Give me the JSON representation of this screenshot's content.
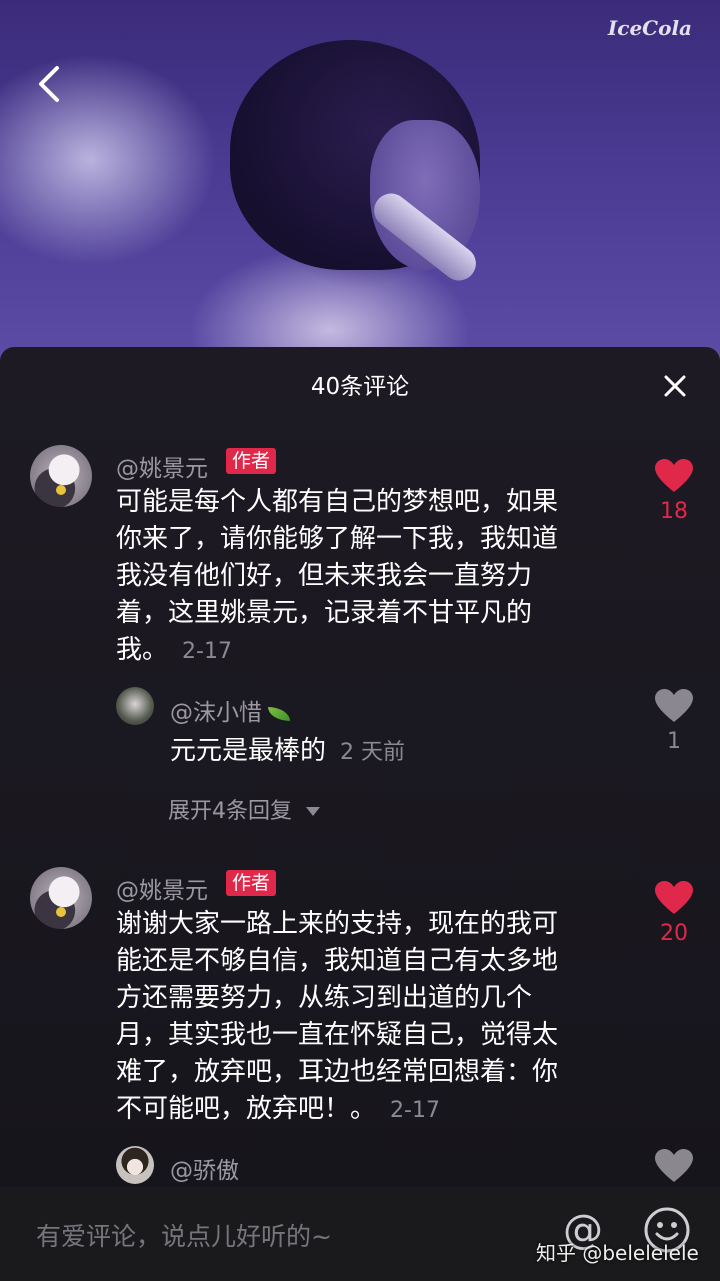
{
  "hero": {
    "watermark": "IceCola"
  },
  "sheet": {
    "title": "40条评论"
  },
  "comments": [
    {
      "username": "@姚景元",
      "badge": "作者",
      "text_lines": [
        "可能是每个人都有自己的梦想吧，如果",
        "你来了，请你能够了解一下我，我知道",
        "我没有他们好，但未来我会一直努力",
        "着，这里姚景元，记录着不甘平凡的"
      ],
      "last_line": "我。",
      "time": "2-17",
      "likes": "18",
      "liked": true,
      "reply": {
        "username": "@沫小惜",
        "text": "元元是最棒的",
        "time": "2 天前",
        "likes": "1",
        "liked": false
      },
      "expand_label": "展开4条回复"
    },
    {
      "username": "@姚景元",
      "badge": "作者",
      "text_lines": [
        "谢谢大家一路上来的支持，现在的我可",
        "能还是不够自信，我知道自己有太多地",
        "方还需要努力，从练习到出道的几个",
        "月，其实我也一直在怀疑自己，觉得太",
        "难了，放弃吧，耳边也经常回想着：你"
      ],
      "last_line": "不可能吧，放弃吧！。",
      "time": "2-17",
      "likes": "20",
      "liked": true,
      "reply": {
        "username": "@骄傲",
        "liked": false
      }
    }
  ],
  "input": {
    "placeholder": "有爱评论，说点儿好听的~"
  },
  "watermark": "知乎 @belelelele",
  "colors": {
    "like_active": "#e0284b",
    "like_inactive": "#8a878f",
    "badge": "#e0284b"
  }
}
